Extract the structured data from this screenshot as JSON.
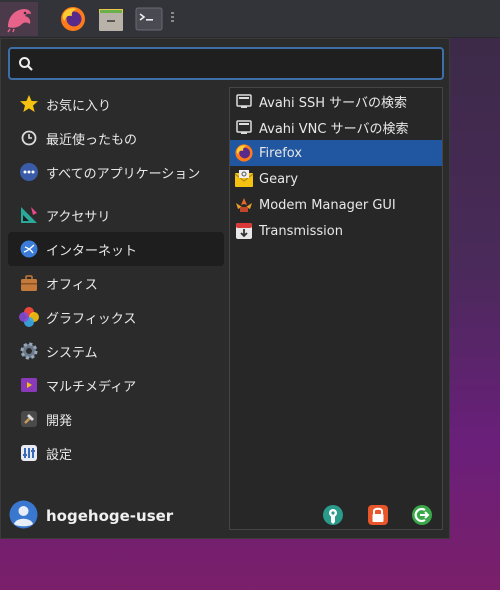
{
  "search": {
    "placeholder": "",
    "value": ""
  },
  "categories": [
    {
      "label": "お気に入り",
      "icon": "star-icon"
    },
    {
      "label": "最近使ったもの",
      "icon": "clock-icon"
    },
    {
      "label": "すべてのアプリケーション",
      "icon": "all-apps-icon"
    },
    {
      "label": "アクセサリ",
      "icon": "accessories-icon"
    },
    {
      "label": "インターネット",
      "icon": "internet-icon",
      "selected": true
    },
    {
      "label": "オフィス",
      "icon": "office-icon"
    },
    {
      "label": "グラフィックス",
      "icon": "graphics-icon"
    },
    {
      "label": "システム",
      "icon": "system-icon"
    },
    {
      "label": "マルチメディア",
      "icon": "multimedia-icon"
    },
    {
      "label": "開発",
      "icon": "development-icon"
    },
    {
      "label": "設定",
      "icon": "settings-icon"
    }
  ],
  "apps": [
    {
      "label": "Avahi SSH サーバの検索",
      "icon": "network-icon"
    },
    {
      "label": "Avahi VNC サーバの検索",
      "icon": "network-icon"
    },
    {
      "label": "Firefox",
      "icon": "firefox-icon",
      "selected": true
    },
    {
      "label": "Geary",
      "icon": "mail-icon"
    },
    {
      "label": "Modem Manager GUI",
      "icon": "modem-icon"
    },
    {
      "label": "Transmission",
      "icon": "transmission-icon"
    }
  ],
  "user": {
    "name": "hogehoge-user"
  },
  "colors": {
    "accent": "#2156a0",
    "selected_category": "#1e1e1e",
    "menu_bg": "#2b2b2b"
  }
}
